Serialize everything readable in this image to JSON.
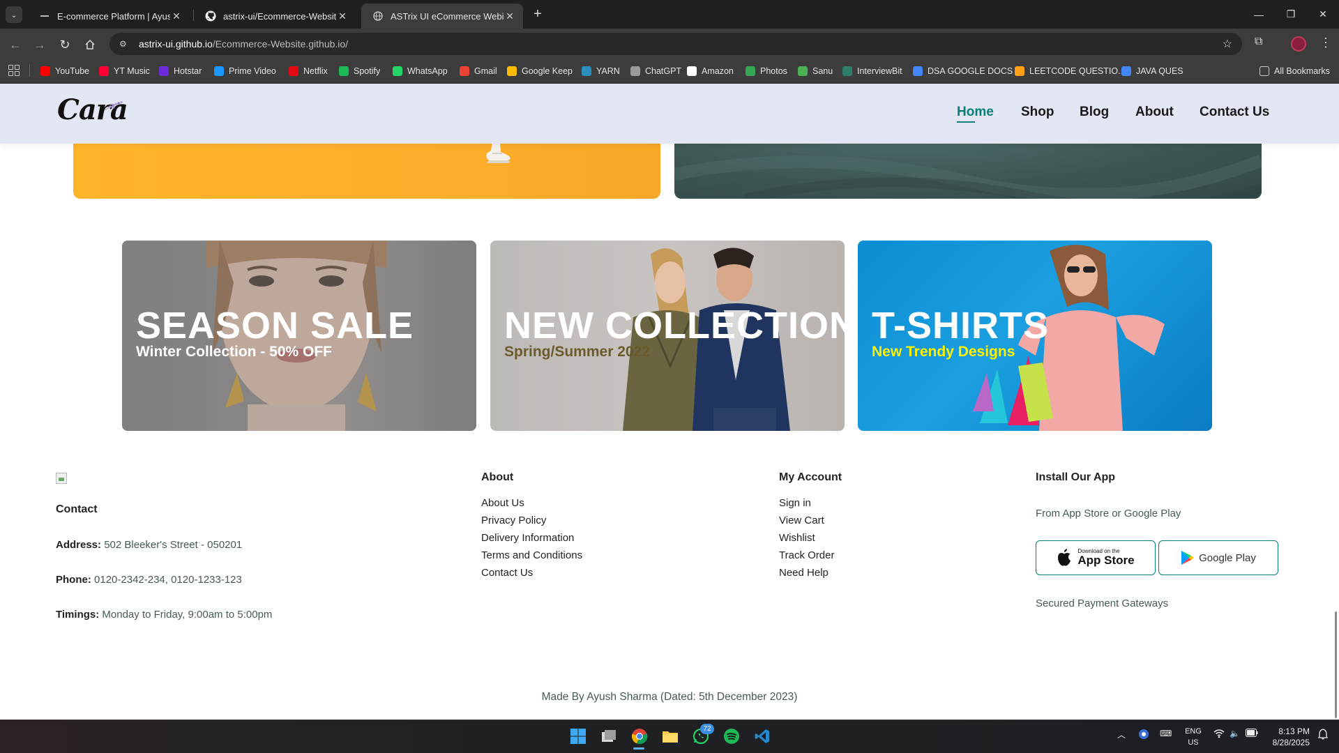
{
  "browser": {
    "tabs": [
      {
        "title": "E-commerce Platform | Ayush S",
        "icon": "generic-favicon"
      },
      {
        "title": "astrix-ui/Ecommerce-Website.g",
        "icon": "github-icon"
      },
      {
        "title": "ASTrix UI eCommerce Webiste",
        "icon": "globe-icon"
      }
    ],
    "url_host": "astrix-ui.github.io",
    "url_path": "/Ecommerce-Website.github.io/",
    "bookmarks": [
      {
        "label": "YouTube",
        "color": "#ff0000"
      },
      {
        "label": "YT Music",
        "color": "#ff0033"
      },
      {
        "label": "Hotstar",
        "color": "#6c2bd9"
      },
      {
        "label": "Prime Video",
        "color": "#1a98ff"
      },
      {
        "label": "Netflix",
        "color": "#e50914"
      },
      {
        "label": "Spotify",
        "color": "#1db954"
      },
      {
        "label": "WhatsApp",
        "color": "#25d366"
      },
      {
        "label": "Gmail",
        "color": "#ea4335"
      },
      {
        "label": "Google Keep",
        "color": "#fbbc04"
      },
      {
        "label": "YARN",
        "color": "#2c8ebb"
      },
      {
        "label": "ChatGPT",
        "color": "#9a9a9a"
      },
      {
        "label": "Amazon",
        "color": "#ffffff"
      },
      {
        "label": "Photos",
        "color": "#34a853"
      },
      {
        "label": "Sanu",
        "color": "#4caf50"
      },
      {
        "label": "InterviewBit",
        "color": "#2e7d6b"
      },
      {
        "label": "DSA GOOGLE DOCS",
        "color": "#4285f4"
      },
      {
        "label": "LEETCODE QUESTIO...",
        "color": "#ffa116"
      },
      {
        "label": "JAVA QUES",
        "color": "#4285f4"
      }
    ],
    "all_bookmarks": "All Bookmarks"
  },
  "site": {
    "logo": "Cara",
    "nav": [
      "Home",
      "Shop",
      "Blog",
      "About",
      "Contact Us"
    ],
    "accent": "#088178",
    "banners": [
      {
        "title": "SEASON SALE",
        "subtitle": "Winter Collection - 50% OFF"
      },
      {
        "title": "NEW COLLECTION",
        "subtitle": "Spring/Summer 2022"
      },
      {
        "title": "T-SHIRTS",
        "subtitle": "New Trendy Designs"
      }
    ]
  },
  "footer": {
    "contact": {
      "heading": "Contact",
      "address_label": "Address:",
      "address": "502 Bleeker's Street - 050201",
      "phone_label": "Phone:",
      "phone": "0120-2342-234, 0120-1233-123",
      "timings_label": "Timings:",
      "timings": "Monday to Friday, 9:00am to 5:00pm"
    },
    "about": {
      "heading": "About",
      "links": [
        "About Us",
        "Privacy Policy",
        "Delivery Information",
        "Terms and Conditions",
        "Contact Us"
      ]
    },
    "account": {
      "heading": "My Account",
      "links": [
        "Sign in",
        "View Cart",
        "Wishlist",
        "Track Order",
        "Need Help"
      ]
    },
    "app": {
      "heading": "Install Our App",
      "subtitle": "From App Store or Google Play",
      "appstore_small": "Download on the",
      "appstore_big": "App Store",
      "googleplay": "Google Play",
      "payments": "Secured Payment Gateways"
    },
    "copyright": "Made By Ayush Sharma (Dated: 5th December 2023)"
  },
  "taskbar": {
    "whatsapp_badge": "72",
    "lang_line1": "ENG",
    "lang_line2": "US",
    "time": "8:13 PM",
    "date": "8/28/2025"
  }
}
